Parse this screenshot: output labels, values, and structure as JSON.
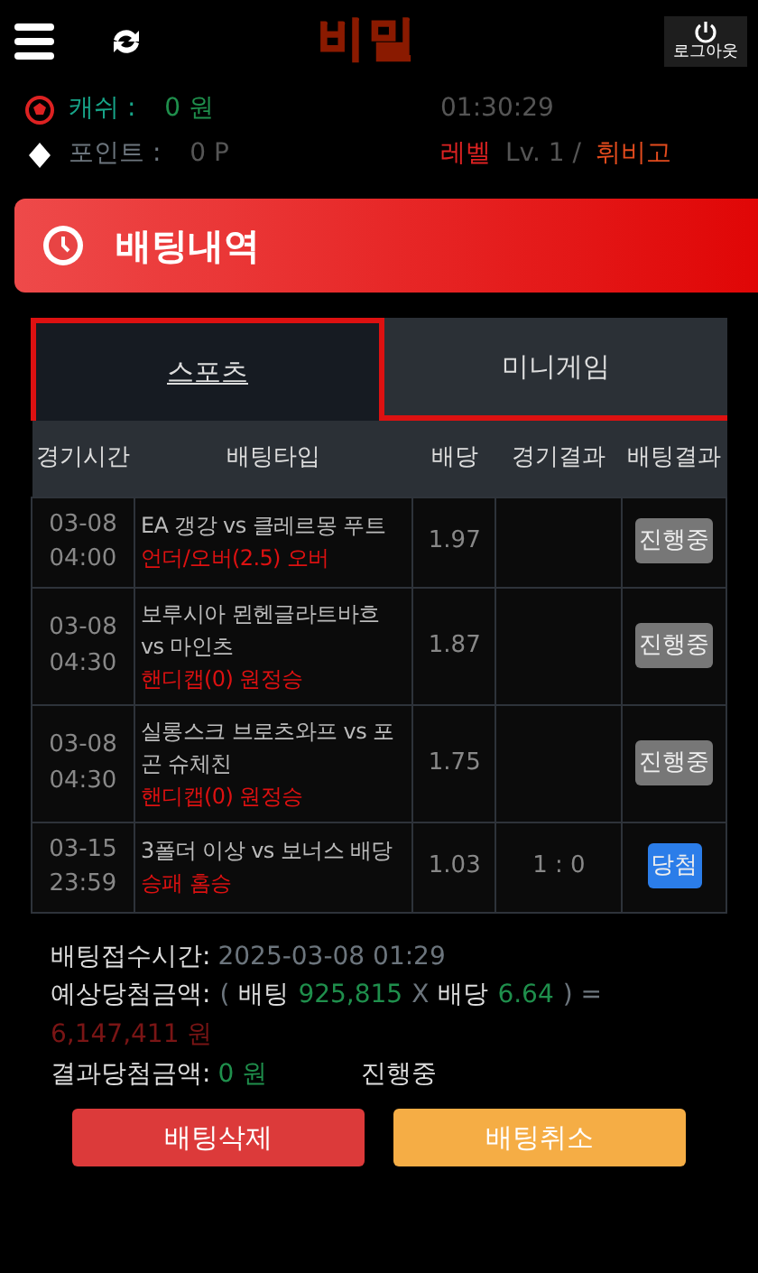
{
  "header": {
    "logo": "비밀",
    "logout": "로그아웃"
  },
  "account": {
    "cash_label": "캐쉬 :",
    "cash_value": "0 원",
    "points_label": "포인트 :",
    "points_value": "0 P",
    "time": "01:30:29",
    "level_label": "레벨",
    "level_value": "Lv. 1 /",
    "nickname": "휘비고"
  },
  "banner": {
    "title": "배팅내역"
  },
  "tabs": [
    {
      "label": "스포츠",
      "selected": true
    },
    {
      "label": "미니게임",
      "selected": false
    }
  ],
  "table": {
    "columns": [
      "경기시간",
      "배팅타입",
      "배당",
      "경기결과",
      "배팅결과"
    ],
    "rows": [
      {
        "date": "03-08",
        "time": "04:00",
        "match": "EA 갱강 vs 클레르몽 푸트",
        "bet": "언더/오버(2.5) 오버",
        "odds": "1.97",
        "status": "진행중",
        "kind": "pending"
      },
      {
        "date": "03-08",
        "time": "04:30",
        "match": "보루시아 묀헨글라트바흐 vs 마인츠",
        "bet": "핸디캡(0) 원정승",
        "odds": "1.87",
        "status": "진행중",
        "kind": "pending"
      },
      {
        "date": "03-08",
        "time": "04:30",
        "match": "실롱스크 브로츠와프 vs 포곤 슈체친",
        "bet": "핸디캡(0) 원정승",
        "odds": "1.75",
        "status": "진행중",
        "kind": "pending"
      },
      {
        "date": "03-15",
        "time": "23:59",
        "match": "3폴더 이상 vs 보너스 배당",
        "bet": "승패 홈승",
        "odds": "1.03",
        "result": "1 : 0",
        "status": "당첨",
        "kind": "won"
      }
    ]
  },
  "summary": {
    "time_label": "배팅접수시간:",
    "time_value": "2025-03-08 01:29",
    "expected_label": "예상당첨금액:",
    "open_paren": "(",
    "bet_label": "배팅",
    "bet_value": "925,815",
    "times": "X",
    "odds_label": "배당",
    "odds_value": "6.64",
    "close_paren": ") =",
    "expected_value": "6,147,411 원",
    "result_label": "결과당첨금액:",
    "result_value": "0 원",
    "state": "진행중"
  },
  "buttons": [
    {
      "label": "배팅삭제",
      "kind": "delete"
    },
    {
      "label": "배팅취소",
      "kind": "cancel"
    }
  ]
}
